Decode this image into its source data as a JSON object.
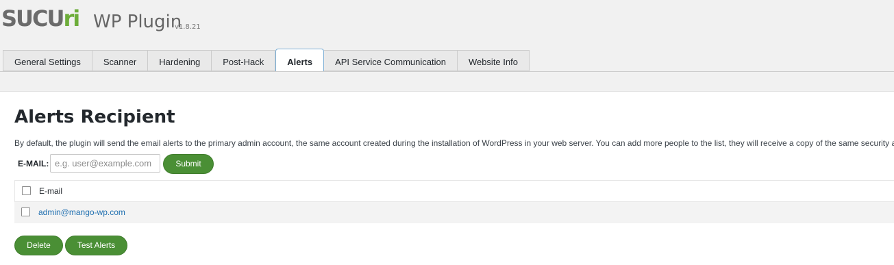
{
  "header": {
    "logo_left": "SUCU",
    "logo_right": "ri",
    "title": "WP Plugin",
    "version": "v1.8.21"
  },
  "tabs": [
    {
      "label": "General Settings",
      "active": false
    },
    {
      "label": "Scanner",
      "active": false
    },
    {
      "label": "Hardening",
      "active": false
    },
    {
      "label": "Post-Hack",
      "active": false
    },
    {
      "label": "Alerts",
      "active": true
    },
    {
      "label": "API Service Communication",
      "active": false
    },
    {
      "label": "Website Info",
      "active": false
    }
  ],
  "panel": {
    "title": "Alerts Recipient",
    "description": "By default, the plugin will send the email alerts to the primary admin account, the same account created during the installation of WordPress in your web server. You can add more people to the list, they will receive a copy of the same security alerts.",
    "email_label": "E-MAIL:",
    "email_placeholder": "e.g. user@example.com",
    "email_value": "",
    "submit_label": "Submit"
  },
  "table": {
    "header": "E-mail",
    "rows": [
      {
        "email": "admin@mango-wp.com",
        "checked": false
      }
    ]
  },
  "actions": {
    "delete_label": "Delete",
    "test_label": "Test Alerts"
  },
  "colors": {
    "accent_green": "#4a8f35",
    "logo_green": "#6dad3a",
    "link_blue": "#2271b1",
    "active_tab_border": "#7eb0d6"
  }
}
